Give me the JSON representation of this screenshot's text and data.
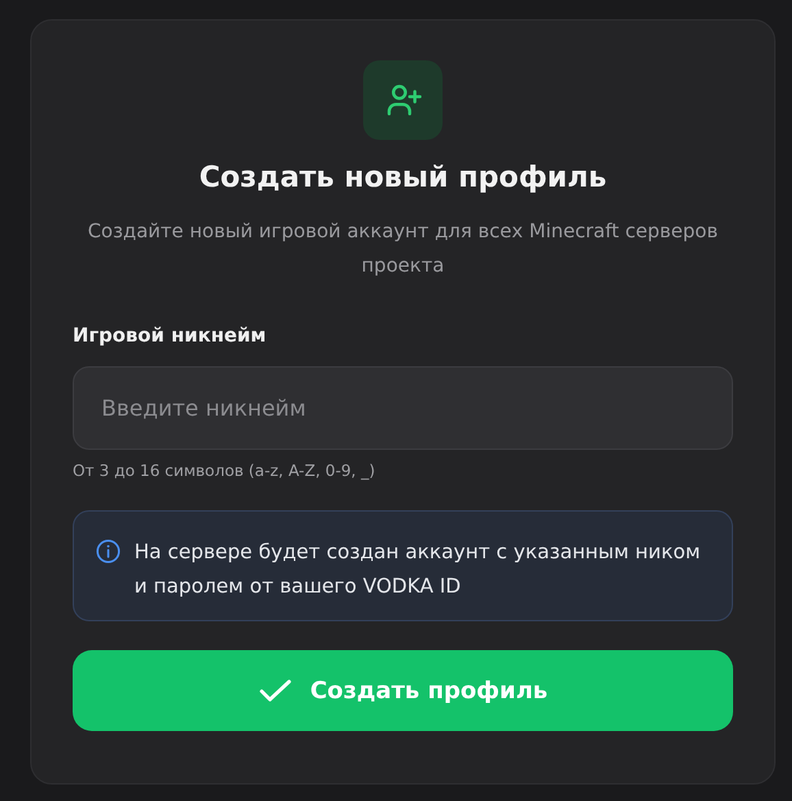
{
  "header": {
    "title": "Создать новый профиль",
    "subtitle": "Создайте новый игровой аккаунт для всех Minecraft серверов проекта"
  },
  "nickname_field": {
    "label": "Игровой никнейм",
    "placeholder": "Введите никнейм",
    "hint": "От 3 до 16 символов (a-z, A-Z, 0-9, _)"
  },
  "info_notice": {
    "text": "На сервере будет создан аккаунт с указанным ником и паролем от вашего VODKA ID"
  },
  "submit_button": {
    "label": "Создать профиль"
  }
}
